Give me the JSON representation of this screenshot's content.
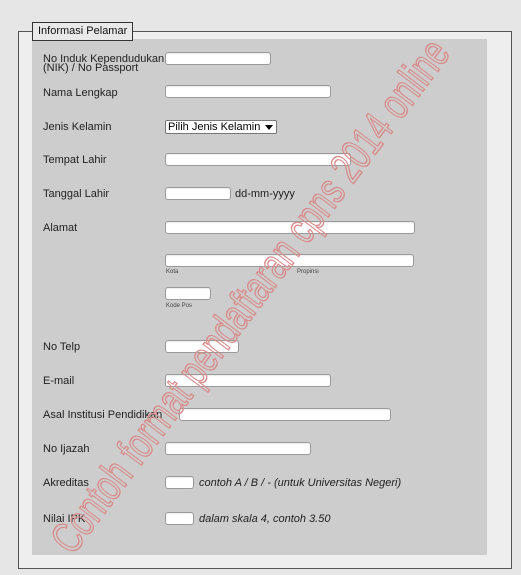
{
  "legend": "Informasi Pelamar",
  "fields": {
    "nik_label_line1": "No Induk Kependudukan",
    "nik_label_line2": "(NIK) / No Passport",
    "nama_label": "Nama Lengkap",
    "jenis_kelamin_label": "Jenis Kelamin",
    "jenis_kelamin_value": "Pilih Jenis Kelamin",
    "tempat_lahir_label": "Tempat Lahir",
    "tanggal_lahir_label": "Tanggal Lahir",
    "tanggal_lahir_hint": "dd-mm-yyyy",
    "alamat_label": "Alamat",
    "kota_sub": "Kota",
    "propinsi_sub": "Propinsi",
    "kode_pos_sub": "Kode Pos",
    "telp_label": "No Telp",
    "email_label": "E-mail",
    "institusi_label": "Asal Institusi Pendidikan",
    "ijazah_label": "No Ijazah",
    "akreditas_label": "Akreditas",
    "akreditas_hint": "contoh A / B / - (untuk Universitas Negeri)",
    "ipk_label": "Nilai IPK",
    "ipk_hint": "dalam skala 4, contoh 3.50"
  },
  "watermark": "Contoh format pendaftaran cpns 2014 online",
  "colors": {
    "watermark": "#d98b8b",
    "panel": "#cdcdcd",
    "page": "#e6e6e6"
  }
}
